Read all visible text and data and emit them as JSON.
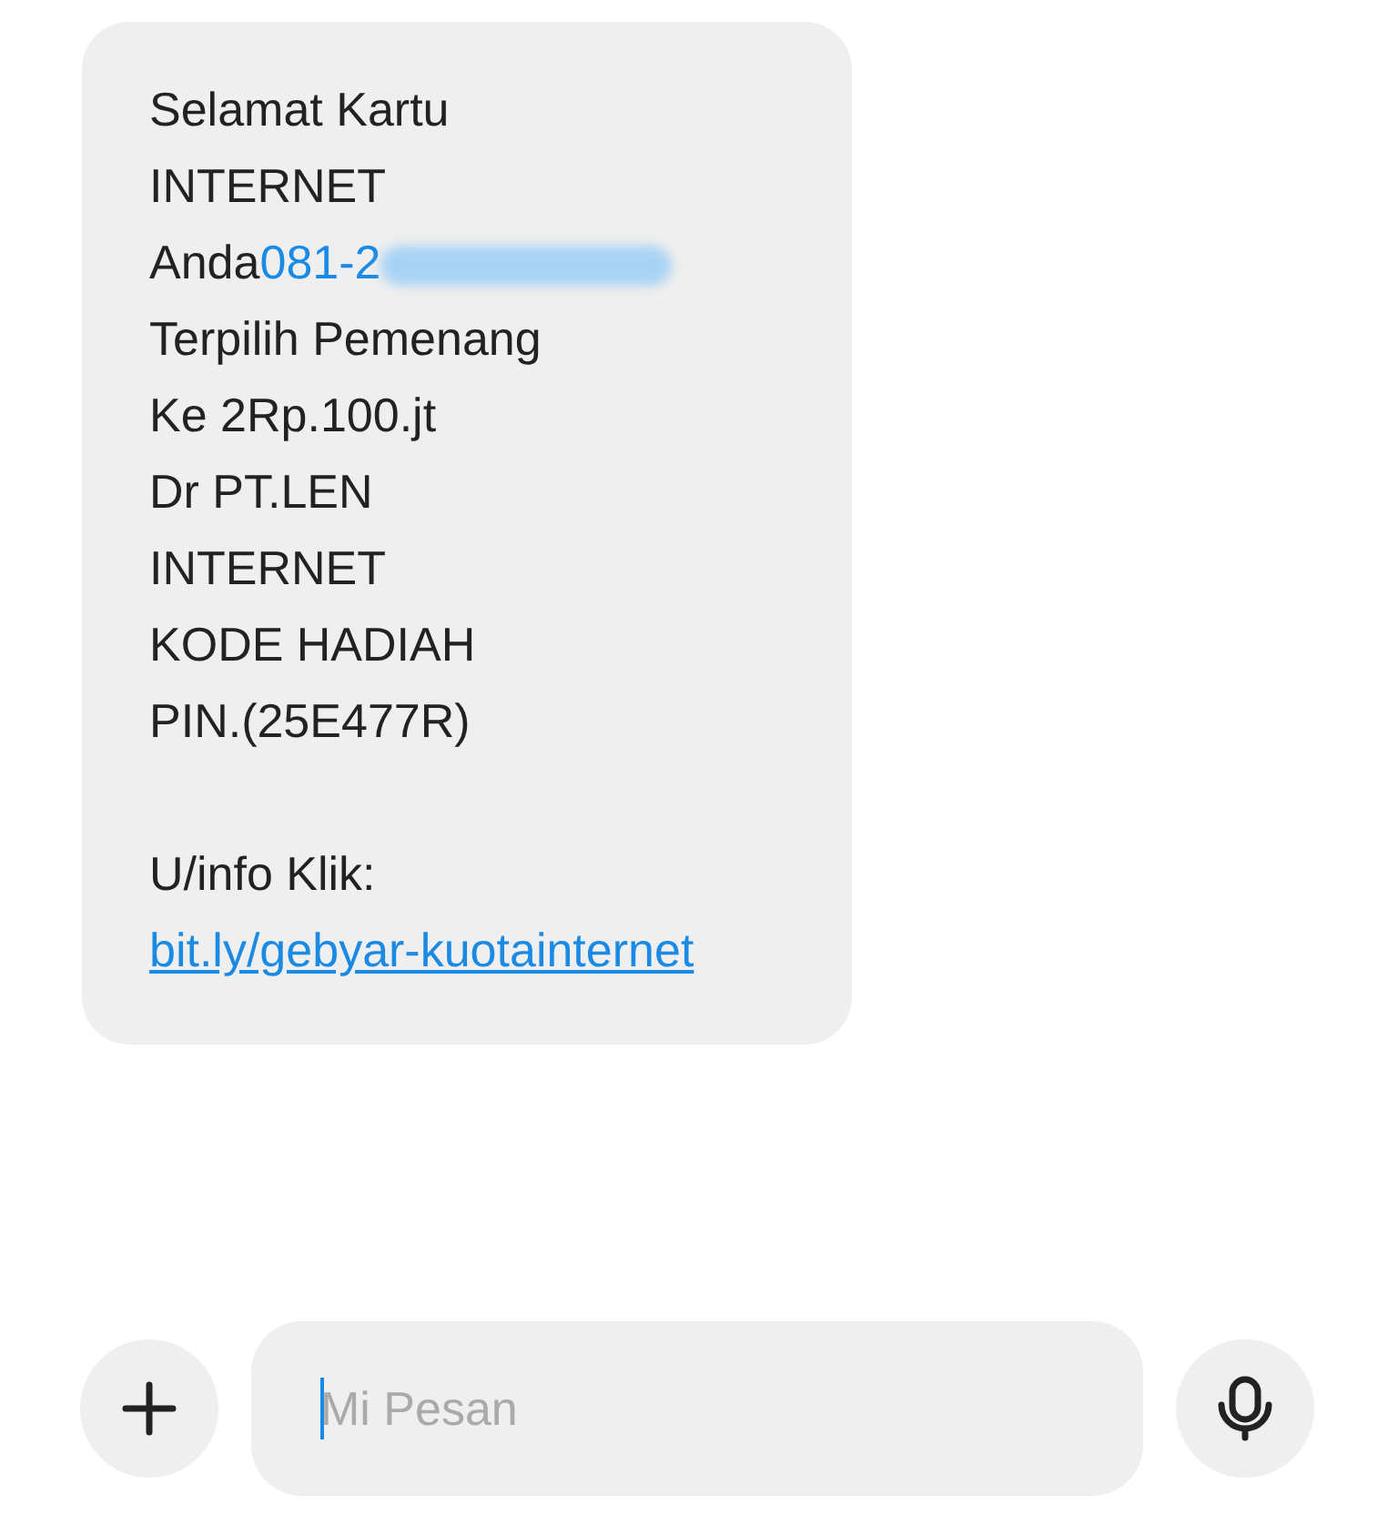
{
  "message": {
    "lines": [
      [
        {
          "kind": "text",
          "text": "Selamat Kartu"
        }
      ],
      [
        {
          "kind": "text",
          "text": "INTERNET"
        }
      ],
      [
        {
          "kind": "text",
          "text": "Anda"
        },
        {
          "kind": "phone",
          "text": "081-2"
        },
        {
          "kind": "redacted"
        }
      ],
      [
        {
          "kind": "text",
          "text": "Terpilih Pemenang"
        }
      ],
      [
        {
          "kind": "text",
          "text": "Ke 2Rp.100.jt"
        }
      ],
      [
        {
          "kind": "text",
          "text": "Dr PT.LEN"
        }
      ],
      [
        {
          "kind": "text",
          "text": "INTERNET"
        }
      ],
      [
        {
          "kind": "text",
          "text": "KODE HADIAH"
        }
      ],
      [
        {
          "kind": "text",
          "text": "PIN.(25E477R)"
        }
      ],
      [
        {
          "kind": "blank"
        }
      ],
      [
        {
          "kind": "text",
          "text": "U/info Klik:"
        }
      ],
      [
        {
          "kind": "link",
          "text": "bit.ly/gebyar-kuotainternet"
        }
      ]
    ]
  },
  "composer": {
    "placeholder": "Mi Pesan"
  }
}
